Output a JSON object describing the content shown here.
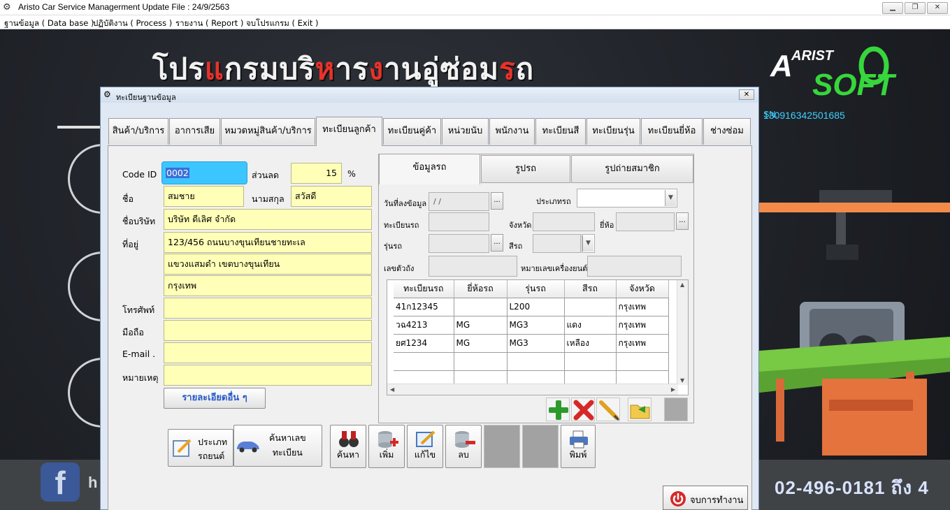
{
  "window": {
    "title": "Aristo Car Service Managerment   Update File : 24/9/2563",
    "minimize": "▁",
    "restore": "❐",
    "close": "✕"
  },
  "menu": [
    "ฐานข้อมูล ( Data base )",
    "ปฏิบัติงาน ( Process )",
    "รายงาน ( Report )",
    "จบโปรแกรม ( Exit )"
  ],
  "banner": {
    "parts": [
      {
        "text": "โปร",
        "color": "w"
      },
      {
        "text": "แ",
        "color": "r"
      },
      {
        "text": "กรม",
        "color": "w"
      },
      {
        "text": "บริ",
        "color": "w"
      },
      {
        "text": "ห",
        "color": "r"
      },
      {
        "text": "าร",
        "color": "w"
      },
      {
        "text": "ง",
        "color": "r"
      },
      {
        "text": "าน",
        "color": "w"
      },
      {
        "text": "อู่ซ่อม",
        "color": "w"
      },
      {
        "text": "ร",
        "color": "r"
      },
      {
        "text": "ถ",
        "color": "w"
      }
    ],
    "logo_top": "ARIST",
    "logo_bottom": "SOFT",
    "sn_label": "SN.",
    "sn_value": "130916342501685",
    "fb_text": "h",
    "phone": "02-496-0181 ถึง 4"
  },
  "colors": {
    "accent": "#3ec6ff",
    "banner_red": "#e8322a",
    "field_yellow": "#ffffb8",
    "logo_green": "#37d63c"
  },
  "dialog": {
    "title": "ทะเบียนฐานข้อมูล",
    "close": "✕",
    "tabs": [
      "สินค้า/บริการ",
      "อาการเสีย",
      "หมวดหมู่สินค้า/บริการ",
      "ทะเบียนลูกค้า",
      "ทะเบียนคู่ค้า",
      "หน่วยนับ",
      "พนักงาน",
      "ทะเบียนสี",
      "ทะเบียนรุ่น",
      "ทะเบียนยี่ห้อ",
      "ช่างซ่อม"
    ],
    "active_tab": "ทะเบียนลูกค้า"
  },
  "customer": {
    "code_label": "Code ID",
    "code": "0002",
    "discount_label": "ส่วนลด",
    "discount": "15",
    "percent": "%",
    "name_label": "ชื่อ",
    "name": "สมชาย",
    "surname_label": "นามสกุล",
    "surname": "สวัสดี",
    "company_label": "ชื่อบริษัท",
    "company": "บริษัท ดีเลิศ  จำกัด",
    "address_label": "ที่อยู่",
    "address1": "123/456  ถนนบางขุนเทียนชายทะเล",
    "address2": "แขวงแสมดำ เขตบางขุนเทียน",
    "address3": "กรุงเทพ",
    "phone_label": "โทรศัพท์",
    "phone": "",
    "mobile_label": "มือถือ",
    "mobile": "",
    "email_label": "E-mail .",
    "email": "",
    "note_label": "หมายเหตุ",
    "note": "",
    "more_button": "รายละเอียดอื่น ๆ"
  },
  "vehicle": {
    "tabs": [
      "ข้อมูลรถ",
      "รูปรถ",
      "รูปถ่ายสมาชิก"
    ],
    "active_tab": "ข้อมูลรถ",
    "date_label": "วันที่ลงข้อมูล",
    "date_value": " /  /",
    "type_label": "ประเภทรถ",
    "type_value": "",
    "plate_label": "ทะเบียนรถ",
    "province_label": "จังหวัด",
    "brand_label": "ยี่ห้อ",
    "model_label": "รุ่นรถ",
    "color_label": "สีรถ",
    "chassis_label": "เลขตัวถัง",
    "engine_label": "หมายเลขเครื่องยนต์",
    "dots": "...",
    "dropdown_arrow": "▼",
    "table": {
      "columns": [
        "ทะเบียนรถ",
        "ยี่ห้อรถ",
        "รุ่นรถ",
        "สีรถ",
        "จังหวัด"
      ],
      "rows": [
        [
          "41ก12345",
          "",
          "L200",
          "",
          "กรุงเทพ"
        ],
        [
          "วฉ4213",
          "MG",
          "MG3",
          "แดง",
          "กรุงเทพ"
        ],
        [
          "ยศ1234",
          "MG",
          "MG3",
          "เหลือง",
          "กรุงเทพ"
        ],
        [
          "",
          "",
          "",
          "",
          ""
        ],
        [
          "",
          "",
          "",
          "",
          ""
        ]
      ]
    }
  },
  "toolbar": {
    "car_type": "ประเภท\nรถยนต์",
    "search_plate": "ค้นหาเลข\nทะเบียน",
    "find": "ค้นหา",
    "add": "เพิ่ม",
    "edit": "แก้ไข",
    "delete": "ลบ",
    "print": "พิมพ์",
    "end_work": "จบการทำงาน"
  }
}
